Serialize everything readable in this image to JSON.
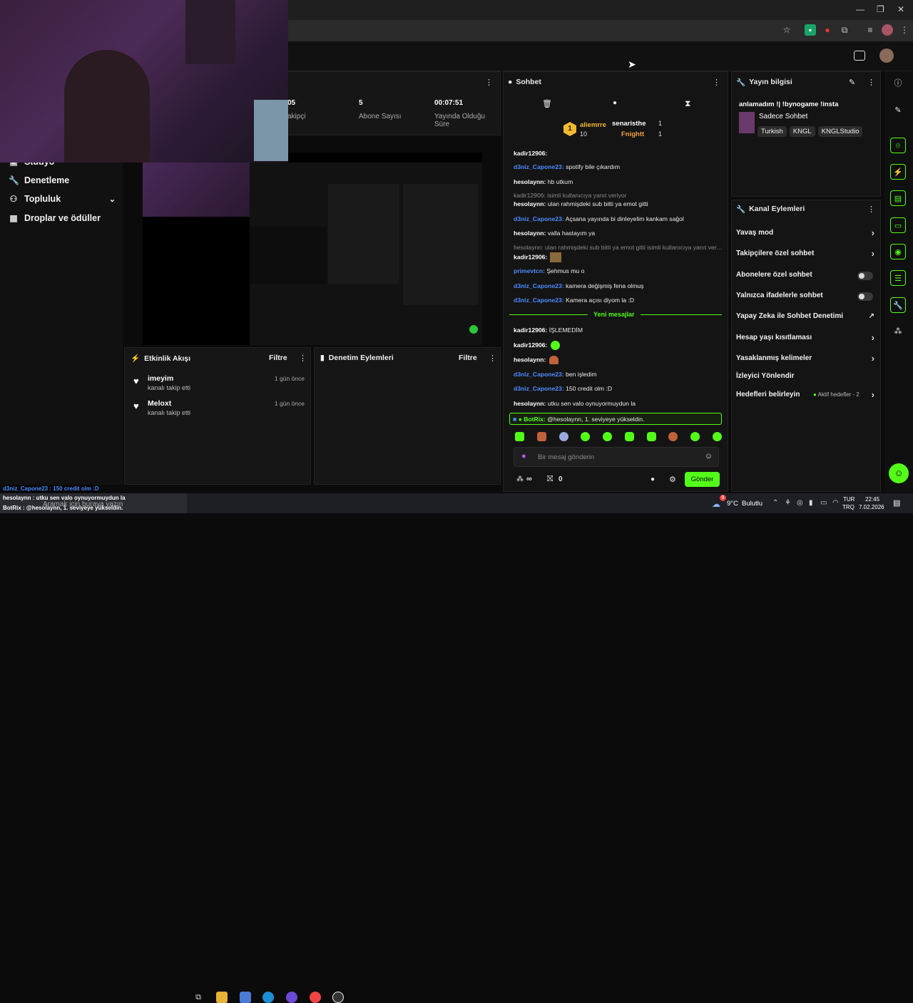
{
  "theme": {
    "accent": "#53fc18",
    "user_blue": "#4d8cff"
  },
  "left_nav": {
    "items": [
      {
        "label": "Stüdyo",
        "icon": "studio-icon"
      },
      {
        "label": "Denetleme",
        "icon": "wrench-icon"
      },
      {
        "label": "Topluluk",
        "icon": "community-icon"
      },
      {
        "label": "Droplar ve ödüller",
        "icon": "gift-icon"
      }
    ]
  },
  "stats": {
    "followers_value": "05",
    "followers_label": "akipçi",
    "subs_value": "5",
    "subs_label": "Abone Sayısı",
    "uptime_value": "00:07:51",
    "uptime_label_1": "Yayında Olduğu",
    "uptime_label_2": "Süre"
  },
  "activity": {
    "title": "Etkinlik Akışı",
    "filter": "Filtre",
    "items": [
      {
        "name": "imeyim",
        "sub": "kanalı takip etti",
        "time": "1 gün önce"
      },
      {
        "name": "Meloxt",
        "sub": "kanalı takip etti",
        "time": "1 gün önce"
      }
    ]
  },
  "mod_actions": {
    "title": "Denetim Eylemleri",
    "filter": "Filtre"
  },
  "chat": {
    "title": "Sohbet",
    "top_gifter": {
      "name": "aliemrre",
      "count": "10"
    },
    "gifters": [
      {
        "name": "senaristhe",
        "count": "1"
      },
      {
        "name": "Fnightt",
        "count": "1"
      }
    ],
    "messages": [
      {
        "user": "kadir12906:",
        "text": "",
        "color": "white"
      },
      {
        "user": "d3niz_Capone23:",
        "text": " spotify bile çıkardım",
        "color": "blue"
      },
      {
        "user": "hesolaynn:",
        "text": " hb utkum",
        "color": "white"
      },
      {
        "reply": "kadir12906:  isimli kullanıcıya yanıt veriyor"
      },
      {
        "user": "hesolaynn:",
        "text": " ulan rahmişdeki sub bitti ya emot gitti",
        "color": "white"
      },
      {
        "user": "d3niz_Capone23:",
        "text": " Açsana yayında bi dinleyelim kankam sağol",
        "color": "blue"
      },
      {
        "user": "hesolaynn:",
        "text": " valla hastayım ya",
        "color": "white"
      },
      {
        "reply": "hesolaynn: ulan rahmişdeki sub bitti ya emot gitti isimli kullanıcıya yanıt veriyor"
      },
      {
        "user": "kadir12906:",
        "text": "",
        "color": "white"
      },
      {
        "user": "primevtcn:",
        "text": " Şehmus mu o",
        "color": "blue"
      },
      {
        "user": "d3niz_Capone23:",
        "text": " kamera değişmiş fena olmuş",
        "color": "blue"
      },
      {
        "user": "d3niz_Capone23:",
        "text": " Kamera açısı diyom la :D",
        "color": "blue"
      }
    ],
    "new_messages": "Yeni mesajlar",
    "messages2": [
      {
        "user": "kadir12906:",
        "text": " İŞLEMEDİM",
        "color": "white"
      },
      {
        "user": "kadir12906:",
        "text": "",
        "color": "white"
      },
      {
        "user": "hesolaynn:",
        "text": "",
        "color": "white"
      },
      {
        "user": "d3niz_Capone23:",
        "text": " ben işledim",
        "color": "blue"
      },
      {
        "user": "d3niz_Capone23:",
        "text": " 150 credit olm :D",
        "color": "blue"
      },
      {
        "user": "hesolaynn:",
        "text": " utku sen valo oynuyormuydun la",
        "color": "white"
      }
    ],
    "bot_message": {
      "user": "BotRix:",
      "text": " @hesolaynn, 1. seviyeye yükseldin."
    },
    "input_placeholder": "Bir mesaj gönderin",
    "points": "∞",
    "gift_count": "0",
    "send_label": "Gönder"
  },
  "stream_info": {
    "title": "Yayın bilgisi",
    "stream_title": "anlamadım !| !bynogame !insta",
    "category": "Sadece Sohbet",
    "tags": [
      "Turkish",
      "KNGL",
      "KNGLStudio"
    ]
  },
  "channel_actions": {
    "title": "Kanal Eylemleri",
    "items": [
      {
        "label": "Yavaş mod",
        "control": "arrow"
      },
      {
        "label": "Takipçilere özel sohbet",
        "control": "arrow"
      },
      {
        "label": "Abonelere özel sohbet",
        "control": "toggle"
      },
      {
        "label": "Yalnızca ifadelerle sohbet",
        "control": "toggle"
      },
      {
        "label": "Yapay Zeka ile Sohbet Denetimi",
        "control": "external"
      },
      {
        "label": "Hesap yaşı kısıtlaması",
        "control": "arrow"
      },
      {
        "label": "Yasaklanmış kelimeler",
        "control": "arrow"
      },
      {
        "label": "İzleyici Yönlendir",
        "control": "none"
      },
      {
        "label": "Hedefleri belirleyin",
        "control": "arrow"
      }
    ],
    "goals_status": "Aktif hedefler - 2"
  },
  "overlay": {
    "line1": "d3niz_Capone23 : 150 credit olm :D",
    "line2": "hesolaynn : utku sen valo oynuyormuydun la",
    "line3": "BotRix : @hesolaynn, 1. seviyeye yükseldin."
  },
  "taskbar": {
    "search_placeholder": "Aramak için buraya yazın",
    "weather_temp": "9°C",
    "weather_text": "Bulutlu",
    "weather_badge": "9",
    "lang_1": "TUR",
    "lang_2": "TRQ",
    "time": "22:45",
    "date": "7.02.2026"
  }
}
